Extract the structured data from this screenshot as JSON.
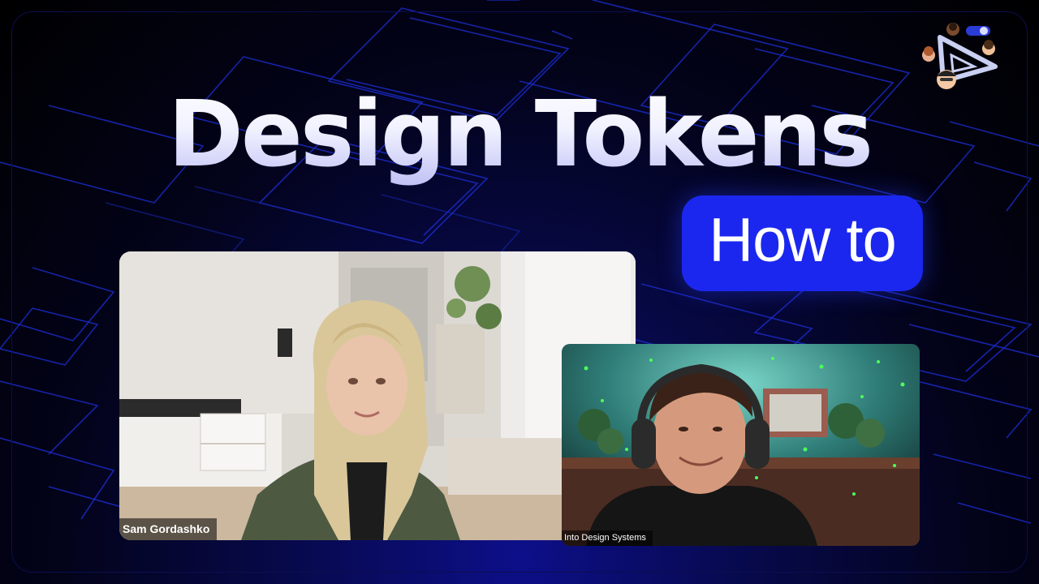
{
  "thumbnail": {
    "title": "Design Tokens",
    "badge": "How to"
  },
  "participants": [
    {
      "name": "Sam Gordashko"
    },
    {
      "name": "Into Design Systems"
    }
  ],
  "colors": {
    "badge_bg": "#1b27ef",
    "background_glow": "#0d0f8a",
    "line_art": "#1d2fd8",
    "title_text": "#eceefe"
  },
  "icons": [
    "brand-triangle-logo-icon",
    "avatar-emoji-icon"
  ]
}
